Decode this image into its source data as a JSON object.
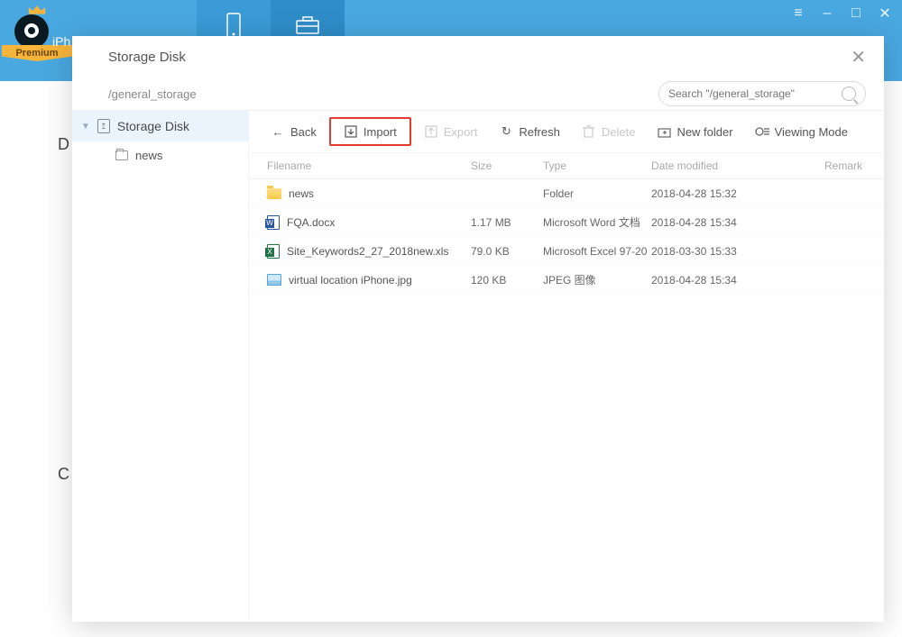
{
  "app": {
    "logo_text": "iPh",
    "premium_label": "Premium"
  },
  "window_controls": {
    "menu": "≡",
    "min": "–",
    "max": "□",
    "close": "✕"
  },
  "modal": {
    "title": "Storage Disk",
    "path": "/general_storage",
    "search_placeholder": "Search \"/general_storage\""
  },
  "sidebar": {
    "root_label": "Storage Disk",
    "children": [
      {
        "label": "news"
      }
    ]
  },
  "toolbar": {
    "back": "Back",
    "import": "Import",
    "export": "Export",
    "refresh": "Refresh",
    "delete": "Delete",
    "new_folder": "New folder",
    "viewing_mode": "Viewing Mode"
  },
  "columns": {
    "filename": "Filename",
    "size": "Size",
    "type": "Type",
    "date": "Date modified",
    "remark": "Remark"
  },
  "files": [
    {
      "icon": "folder",
      "name": "news",
      "size": "",
      "type": "Folder",
      "date": "2018-04-28 15:32",
      "remark": ""
    },
    {
      "icon": "doc",
      "name": "FQA.docx",
      "size": "1.17 MB",
      "type": "Microsoft Word 文档",
      "date": "2018-04-28 15:34",
      "remark": ""
    },
    {
      "icon": "xls",
      "name": "Site_Keywords2_27_2018new.xls",
      "size": "79.0 KB",
      "type": "Microsoft Excel 97-20",
      "date": "2018-03-30 15:33",
      "remark": ""
    },
    {
      "icon": "img",
      "name": "virtual location iPhone.jpg",
      "size": "120 KB",
      "type": "JPEG 图像",
      "date": "2018-04-28 15:34",
      "remark": ""
    }
  ],
  "bg_hints": {
    "d": "D",
    "c": "C"
  }
}
